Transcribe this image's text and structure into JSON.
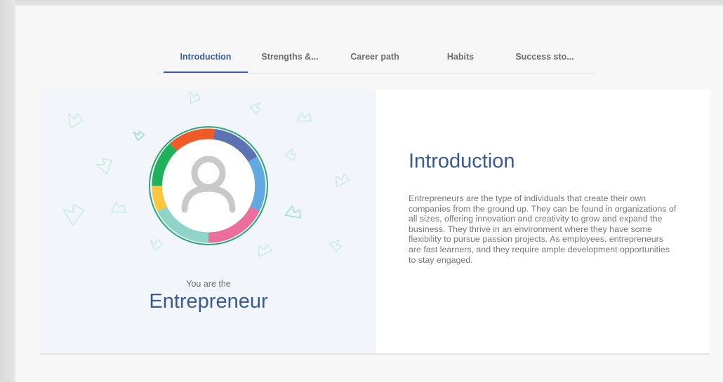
{
  "tabs": [
    {
      "label": "Introduction",
      "active": true
    },
    {
      "label": "Strengths &..."
    },
    {
      "label": "Career path"
    },
    {
      "label": "Habits"
    },
    {
      "label": "Success sto..."
    }
  ],
  "profile": {
    "you_are_label": "You are the",
    "persona_name": "Entrepreneur",
    "avatar_icon": "user-avatar-icon",
    "ring_colors": [
      "#f05a28",
      "#5d73b1",
      "#62a9e1",
      "#ea6f9a",
      "#8fd3c9",
      "#ffc53d",
      "#1fb25a"
    ],
    "ring_border_color": "#2aa876"
  },
  "introduction": {
    "title": "Introduction",
    "body": "Entrepreneurs are the type of individuals that create their own companies from the ground up. They can be found in organizations of all sizes, offering innovation and creativity to grow and expand the business. They thrive in an environment where they have some flexibility to pursue passion projects. As employees, entrepreneurs are fast learners, and they require ample development opportunities to stay engaged."
  },
  "colors": {
    "accent": "#3b5d9b",
    "crown_outline": "#bde8e3"
  }
}
